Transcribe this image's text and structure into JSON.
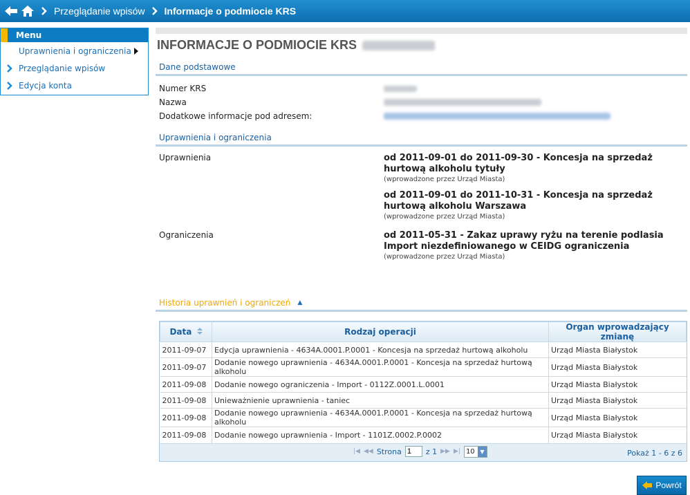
{
  "breadcrumb": {
    "items": [
      "Przeglądanie wpisów",
      "Informacje o podmiocie KRS"
    ]
  },
  "menu": {
    "title": "Menu",
    "items": [
      "Uprawnienia i ograniczenia",
      "Przeglądanie wpisów",
      "Edycja konta"
    ]
  },
  "page": {
    "title": "INFORMACJE O PODMIOCIE KRS"
  },
  "basic": {
    "title": "Dane podstawowe",
    "krs_label": "Numer KRS",
    "name_label": "Nazwa",
    "info_label": "Dodatkowe informacje pod adresem:"
  },
  "rights": {
    "title": "Uprawnienia i ograniczenia",
    "perm_label": "Uprawnienia",
    "perms": [
      {
        "text": "od 2011-09-01 do 2011-09-30 - Koncesja na sprzedaż hurtową alkoholu tytuły",
        "note": "(wprowadzone przez Urząd Miasta)"
      },
      {
        "text": "od 2011-09-01 do 2011-10-31 - Koncesja na sprzedaż hurtową alkoholu Warszawa",
        "note": "(wprowadzone przez Urząd Miasta)"
      }
    ],
    "limit_label": "Ograniczenia",
    "limits": [
      {
        "text": "od 2011-05-31 - Zakaz uprawy ryżu na terenie podlasia Import niezdefiniowanego w CEIDG ograniczenia",
        "note": "(wprowadzone przez Urząd Miasta)"
      }
    ]
  },
  "history": {
    "title": "Historia uprawnień i ograniczeń",
    "columns": [
      "Data",
      "Rodzaj operacji",
      "Organ wprowadzający zmianę"
    ],
    "rows": [
      [
        "2011-09-07",
        "Edycja uprawnienia - 4634A.0001.P.0001 - Koncesja na sprzedaż hurtową alkoholu",
        "Urząd Miasta Białystok"
      ],
      [
        "2011-09-07",
        "Dodanie nowego uprawnienia - 4634A.0001.P.0001 - Koncesja na sprzedaż hurtową alkoholu",
        "Urząd Miasta Białystok"
      ],
      [
        "2011-09-08",
        "Dodanie nowego ograniczenia - Import - 0112Z.0001.L.0001",
        "Urząd Miasta Białystok"
      ],
      [
        "2011-09-08",
        "Unieważnienie uprawnienia - taniec",
        "Urząd Miasta Białystok"
      ],
      [
        "2011-09-08",
        "Dodanie nowego uprawnienia - 4634A.0001.P.0001 - Koncesja na sprzedaż hurtową alkoholu",
        "Urząd Miasta Białystok"
      ],
      [
        "2011-09-08",
        "Dodanie nowego uprawnienia - Import - 1101Z.0002.P.0002",
        "Urząd Miasta Białystok"
      ]
    ],
    "pager": {
      "page_label": "Strona",
      "page_value": "1",
      "of_label": "z 1",
      "page_size": "10",
      "summary": "Pokaż 1 - 6 z 6"
    }
  },
  "back_button": "Powrót"
}
